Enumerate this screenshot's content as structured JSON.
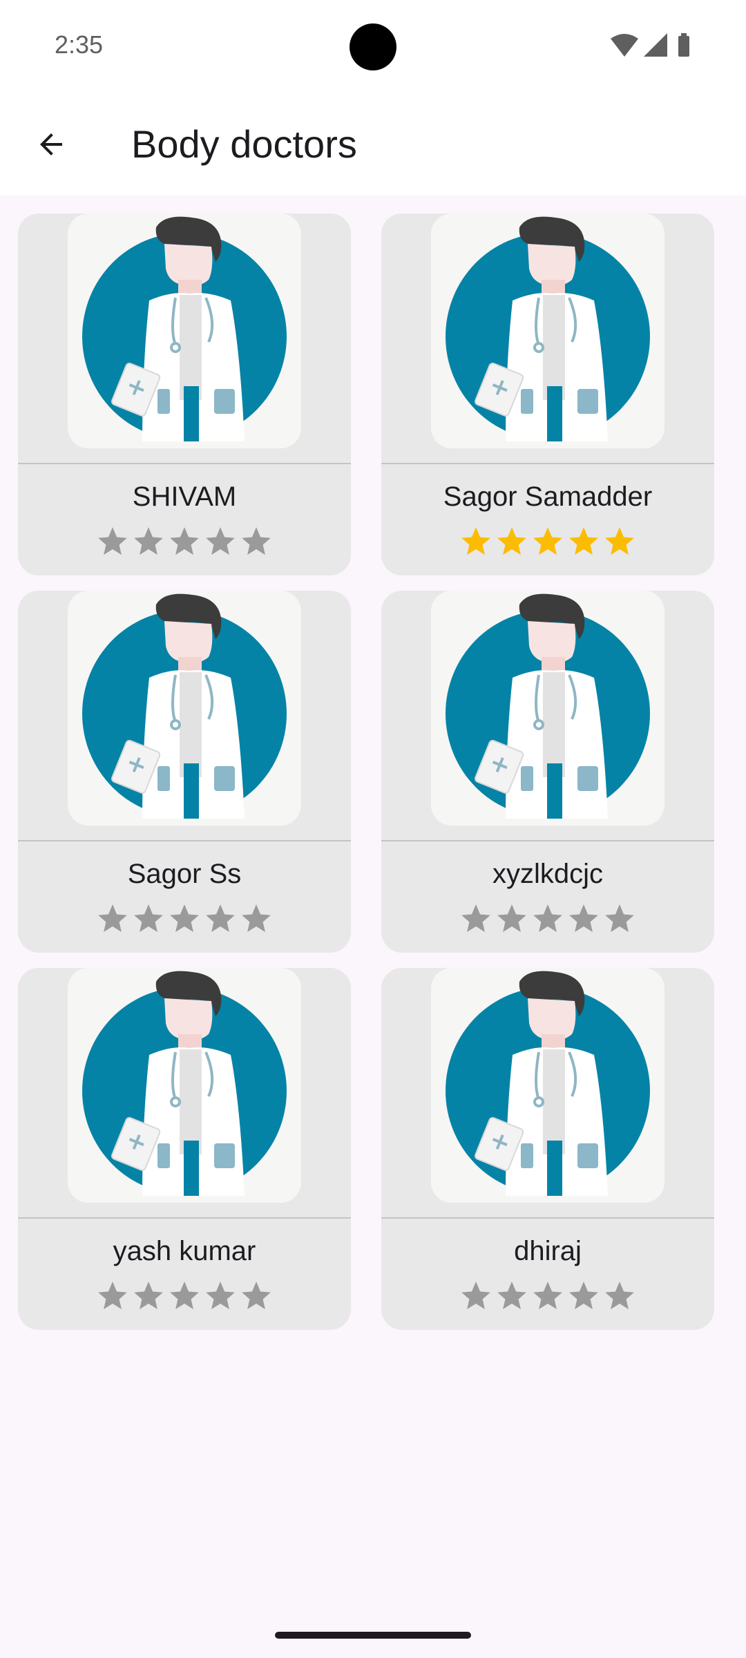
{
  "status_bar": {
    "time": "2:35",
    "icons": [
      "wifi-icon",
      "cellular-signal-icon",
      "battery-icon"
    ]
  },
  "app_bar": {
    "title": "Body doctors",
    "back_icon": "arrow-left-icon"
  },
  "colors": {
    "background": "#fbf6fb",
    "card": "#e8e8e8",
    "star_active": "#fbbc04",
    "star_inactive": "#9a9a9a",
    "avatar_circle": "#0583a6"
  },
  "doctors": [
    {
      "name": "SHIVAM",
      "rating": 0,
      "max_rating": 5
    },
    {
      "name": "Sagor Samadder",
      "rating": 5,
      "max_rating": 5
    },
    {
      "name": "Sagor Ss",
      "rating": 0,
      "max_rating": 5
    },
    {
      "name": "xyzlkdcjc",
      "rating": 0,
      "max_rating": 5
    },
    {
      "name": "yash kumar",
      "rating": 0,
      "max_rating": 5
    },
    {
      "name": "dhiraj",
      "rating": 0,
      "max_rating": 5
    }
  ]
}
